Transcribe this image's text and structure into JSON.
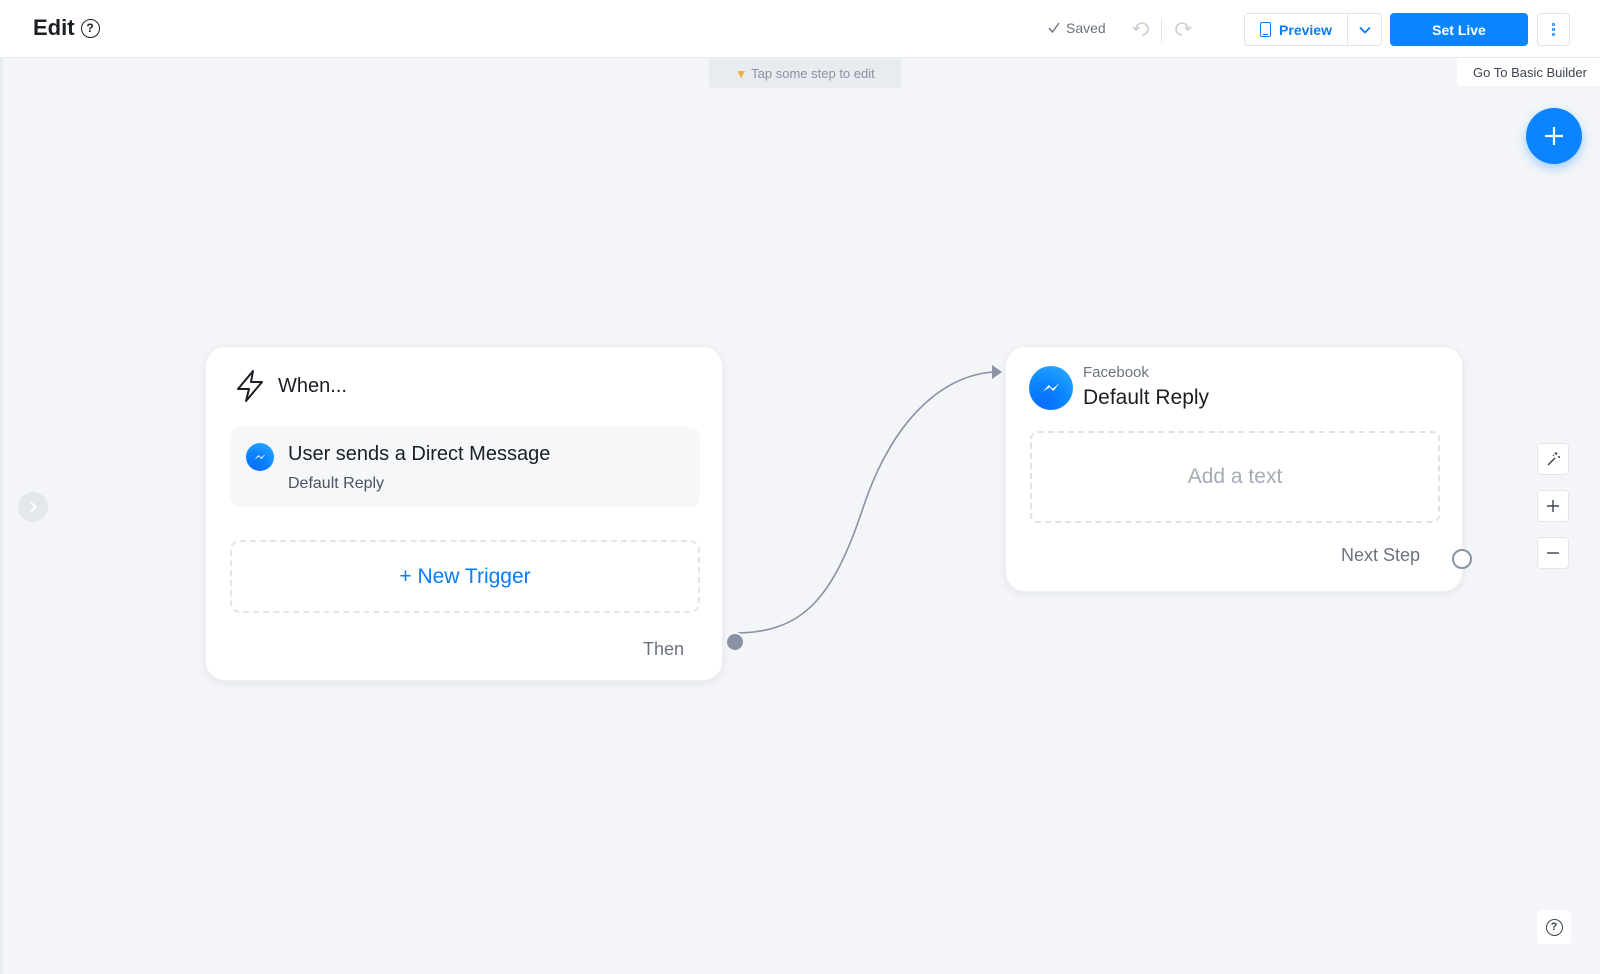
{
  "header": {
    "title": "Edit",
    "help_symbol": "?",
    "saved_label": "Saved",
    "preview_label": "Preview",
    "set_live_label": "Set Live"
  },
  "canvas": {
    "hint": "Tap some step to edit",
    "hint_icon": "pointing-down-hand-icon",
    "basic_builder_label": "Go To Basic Builder"
  },
  "trigger_card": {
    "title": "When...",
    "trigger": {
      "title": "User sends a Direct Message",
      "subtitle": "Default Reply",
      "icon": "messenger-icon"
    },
    "new_trigger_label": "+ New Trigger",
    "then_label": "Then"
  },
  "reply_card": {
    "platform": "Facebook",
    "title": "Default Reply",
    "add_text_placeholder": "Add a text",
    "next_step_label": "Next Step",
    "icon": "messenger-icon"
  },
  "colors": {
    "accent": "#0a84ff",
    "canvas_bg": "#f3f5f8",
    "connector": "#8993a3"
  }
}
